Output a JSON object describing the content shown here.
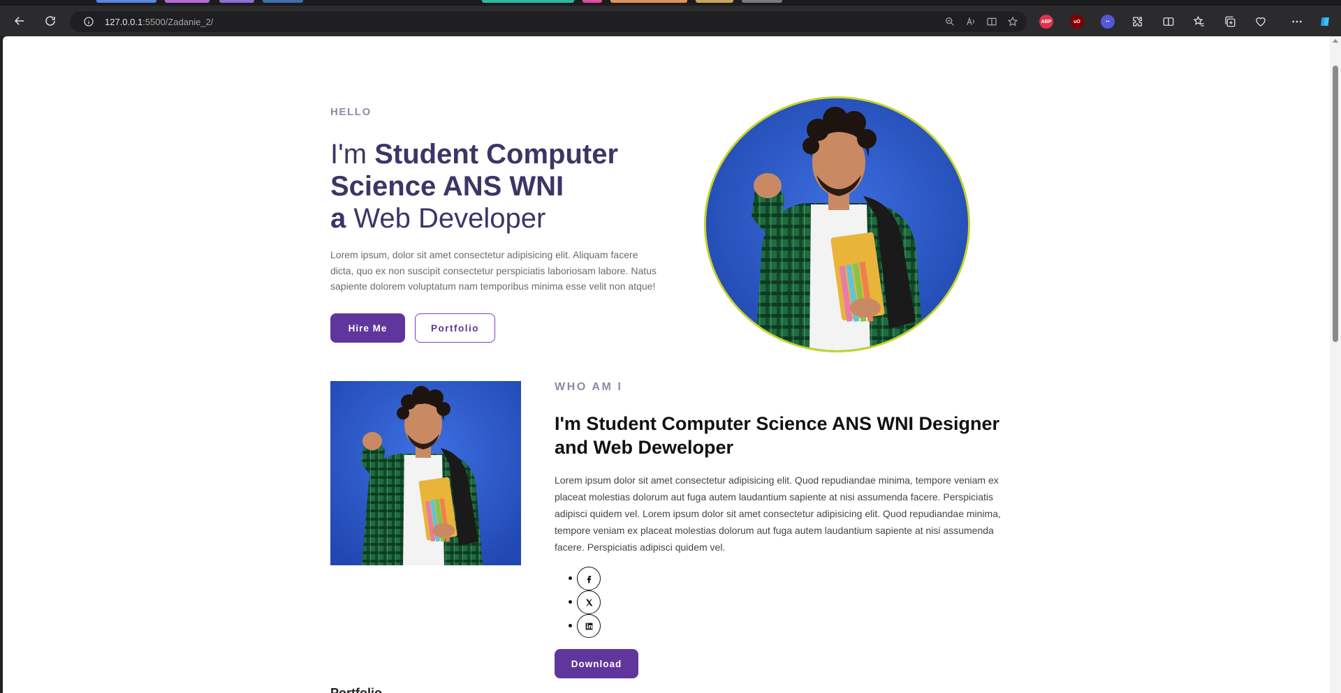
{
  "browser": {
    "url_host": "127.0.0.1",
    "url_rest": ":5500/Zadanie_2/",
    "tab_colors": [
      "#5a86e6",
      "#b969d6",
      "#8a6fd6",
      "#3f6fb0",
      "#2fb8a2",
      "#e04ca0",
      "#e0925a",
      "#c9a659",
      "#7a7a7a"
    ],
    "extensions": [
      {
        "name": "abp",
        "label": "ABP",
        "color": "#e0344b"
      },
      {
        "name": "ublock",
        "label": "uO",
        "color": "#800000"
      },
      {
        "name": "ghost",
        "label": "",
        "color": "#5458d9"
      }
    ]
  },
  "hero": {
    "eyebrow": "HELLO",
    "title_prefix": "I'm ",
    "title_bold": "Student Computer Science ANS WNI",
    "title_a": "a",
    "title_role": " Web Developer",
    "text": "Lorem ipsum, dolor sit amet consectetur adipisicing elit. Aliquam facere dicta, quo ex non suscipit consectetur perspiciatis laboriosam labore. Natus sapiente dolorem voluptatum nam temporibus minima esse velit non atque!",
    "hire_label": "Hire Me",
    "portfolio_label": "Portfolio",
    "accent": "#61369c",
    "ring": "#c4d52a"
  },
  "about": {
    "eyebrow": "WHO AM I",
    "title": "I'm Student Computer Science ANS WNI Designer and Web Deweloper",
    "text": "Lorem ipsum dolor sit amet consectetur adipisicing elit. Quod repudiandae minima, tempore veniam ex placeat molestias dolorum aut fuga autem laudantium sapiente at nisi assumenda facere. Perspiciatis adipisci quidem vel. Lorem ipsum dolor sit amet consectetur adipisicing elit. Quod repudiandae minima, tempore veniam ex placeat molestias dolorum aut fuga autem laudantium sapiente at nisi assumenda facere. Perspiciatis adipisci quidem vel.",
    "socials": [
      {
        "name": "facebook",
        "icon": "facebook-icon"
      },
      {
        "name": "x",
        "icon": "x-twitter-icon"
      },
      {
        "name": "linkedin",
        "icon": "linkedin-icon"
      }
    ],
    "download_label": "Download"
  },
  "next_section": {
    "title_partial": "Portfolio"
  }
}
